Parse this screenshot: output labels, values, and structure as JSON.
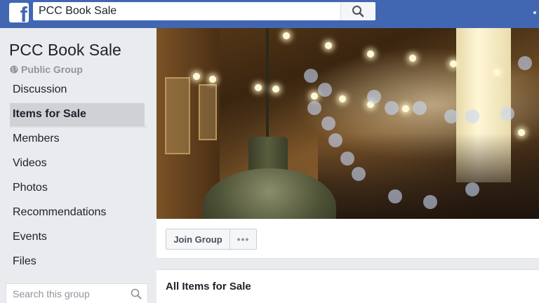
{
  "topbar": {
    "logo_letter": "f",
    "logo_icon": "facebook-logo-icon",
    "search_value": "PCC Book Sale",
    "search_icon": "search-icon",
    "brand_color": "#4267b2"
  },
  "group": {
    "title": "PCC Book Sale",
    "privacy_icon": "globe-icon",
    "privacy_label": "Public Group"
  },
  "sidebar": {
    "items": [
      {
        "label": "Discussion",
        "active": false
      },
      {
        "label": "Items for Sale",
        "active": true
      },
      {
        "label": "Members",
        "active": false
      },
      {
        "label": "Videos",
        "active": false
      },
      {
        "label": "Photos",
        "active": false
      },
      {
        "label": "Recommendations",
        "active": false
      },
      {
        "label": "Events",
        "active": false
      },
      {
        "label": "Files",
        "active": false
      }
    ],
    "search_placeholder": "Search this group",
    "search_icon": "search-icon"
  },
  "cover": {
    "image_name": "cover-photo"
  },
  "actions": {
    "join_label": "Join Group",
    "more_label": "•••",
    "more_icon": "more-options-icon"
  },
  "items_panel": {
    "title": "All Items for Sale"
  }
}
